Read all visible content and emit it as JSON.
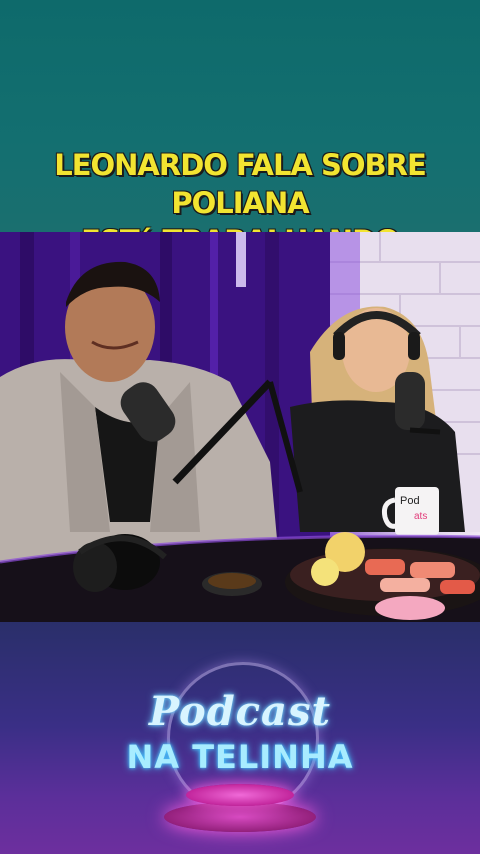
{
  "caption": {
    "line1": "LEONARDO FALA SOBRE POLIANA",
    "line2": "ESTá TRABALHANDO"
  },
  "mug": {
    "text_top": "Pod",
    "text_bottom": "ats"
  },
  "logo": {
    "word1": "Podcast",
    "word2": "NA TELINHA"
  },
  "colors": {
    "caption_text": "#f2e431",
    "top_band": "#136f70",
    "logo_glow": "#6fd3ff",
    "stage_pink": "#e24fc8"
  }
}
